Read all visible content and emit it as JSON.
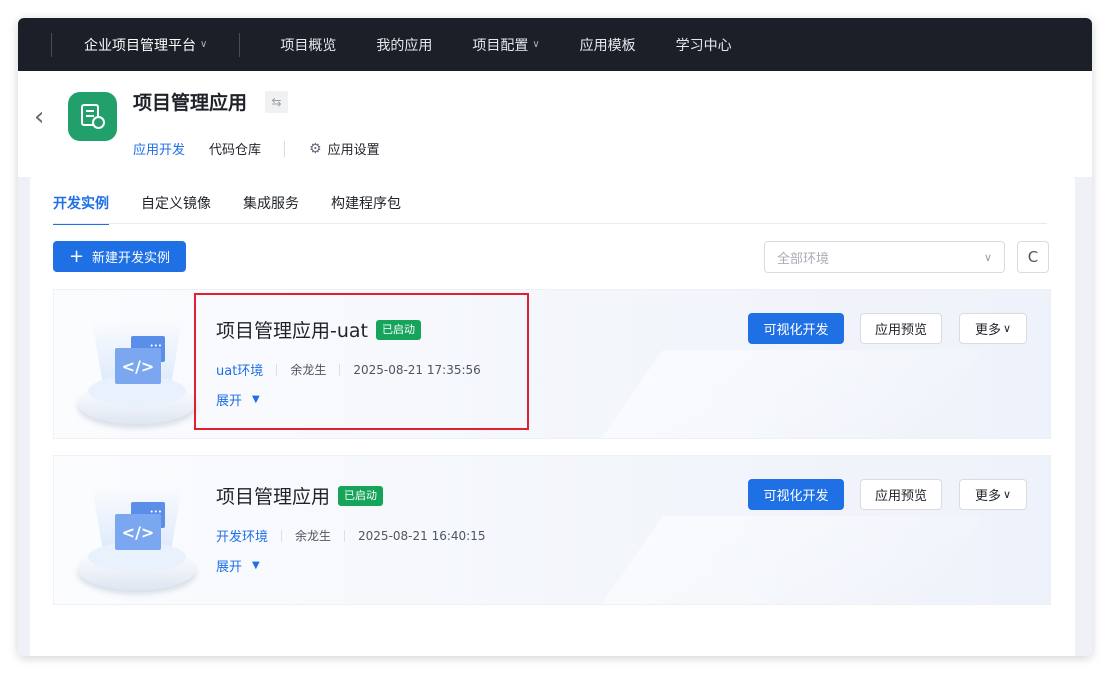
{
  "topnav": {
    "platform": "企业项目管理平台",
    "items": [
      {
        "label": "项目概览",
        "has_dropdown": false
      },
      {
        "label": "我的应用",
        "has_dropdown": false
      },
      {
        "label": "项目配置",
        "has_dropdown": true
      },
      {
        "label": "应用模板",
        "has_dropdown": false
      },
      {
        "label": "学习中心",
        "has_dropdown": false
      }
    ]
  },
  "app": {
    "title": "项目管理应用",
    "tabs": {
      "dev": "应用开发",
      "repo": "代码仓库",
      "settings": "应用设置"
    }
  },
  "subtabs": [
    "开发实例",
    "自定义镜像",
    "集成服务",
    "构建程序包"
  ],
  "toolbar": {
    "new_button": "新建开发实例",
    "env_placeholder": "全部环境"
  },
  "instances": [
    {
      "title": "项目管理应用-uat",
      "status": "已启动",
      "env": "uat环境",
      "owner": "余龙生",
      "time": "2025-08-21 17:35:56",
      "expand": "展开",
      "buttons": {
        "primary": "可视化开发",
        "preview": "应用预览",
        "more": "更多"
      }
    },
    {
      "title": "项目管理应用",
      "status": "已启动",
      "env": "开发环境",
      "owner": "余龙生",
      "time": "2025-08-21 16:40:15",
      "expand": "展开",
      "buttons": {
        "primary": "可视化开发",
        "preview": "应用预览",
        "more": "更多"
      }
    }
  ],
  "colors": {
    "accent": "#1f6fe5",
    "status_green": "#16a35a",
    "topnav_bg": "#1b1f27",
    "highlight": "#e0202e"
  }
}
